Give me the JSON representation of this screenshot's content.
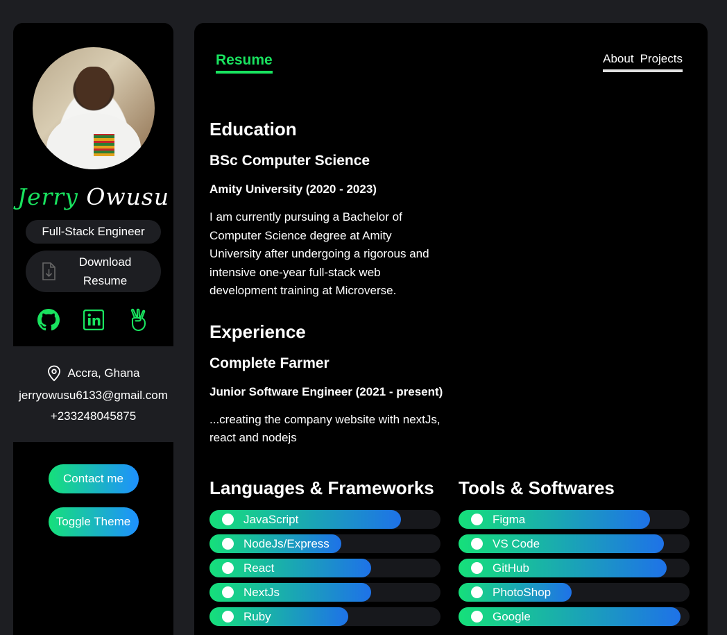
{
  "profile": {
    "first_name": "Jerry",
    "last_name": "Owusu",
    "role": "Full-Stack Engineer",
    "download_label": "Download Resume",
    "location": "Accra, Ghana",
    "email": "jerryowusu6133@gmail.com",
    "phone": "+233248045875",
    "contact_label": "Contact me",
    "theme_label": "Toggle Theme",
    "socials": [
      "github-icon",
      "linkedin-icon",
      "angellist-icon"
    ]
  },
  "nav": {
    "active_tab": "Resume",
    "links": [
      "About",
      "Projects"
    ]
  },
  "education": {
    "heading": "Education",
    "degree": "BSc Computer Science",
    "school": "Amity University (2020 - 2023)",
    "description": "I am currently pursuing a Bachelor of Computer Science degree at Amity University after undergoing a rigorous and intensive one-year full-stack web development training at Microverse."
  },
  "experience": {
    "heading": "Experience",
    "company": "Complete Farmer",
    "position": "Junior Software Engineer (2021 - present)",
    "description": "...creating the company website with nextJs, react and nodejs"
  },
  "languages": {
    "heading": "Languages & Frameworks",
    "items": [
      {
        "name": "JavaScript",
        "level": 0.83
      },
      {
        "name": "NodeJs/Express",
        "level": 0.57
      },
      {
        "name": "React",
        "level": 0.7
      },
      {
        "name": "NextJs",
        "level": 0.7
      },
      {
        "name": "Ruby",
        "level": 0.6
      }
    ]
  },
  "tools": {
    "heading": "Tools & Softwares",
    "items": [
      {
        "name": "Figma",
        "level": 0.83
      },
      {
        "name": "VS Code",
        "level": 0.89
      },
      {
        "name": "GitHub",
        "level": 0.9
      },
      {
        "name": "PhotoShop",
        "level": 0.49
      },
      {
        "name": "Google",
        "level": 0.96
      }
    ]
  },
  "colors": {
    "accent": "#19e35f",
    "gradient_start": "#16e07a",
    "gradient_end": "#1e72e8",
    "panel": "#000000",
    "background": "#1d1e22"
  }
}
